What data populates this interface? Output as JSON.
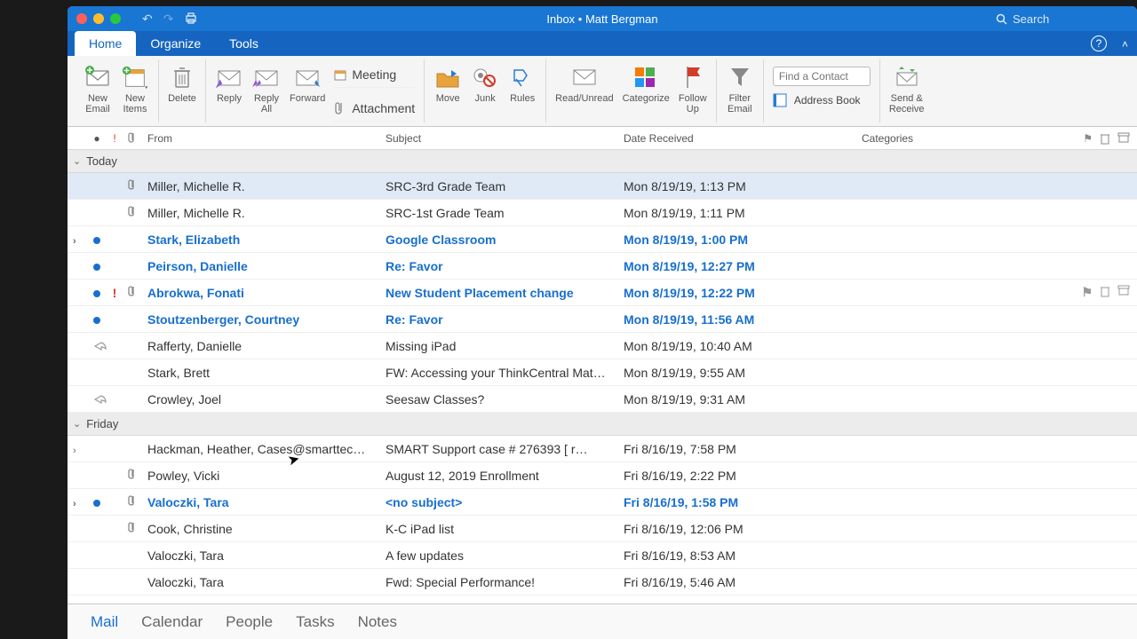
{
  "title": "Inbox • Matt Bergman",
  "search_placeholder": "Search",
  "tabs": {
    "home": "Home",
    "organize": "Organize",
    "tools": "Tools"
  },
  "ribbon": {
    "new_email": "New\nEmail",
    "new_items": "New\nItems",
    "delete": "Delete",
    "reply": "Reply",
    "reply_all": "Reply\nAll",
    "forward": "Forward",
    "meeting": "Meeting",
    "attachment": "Attachment",
    "move": "Move",
    "junk": "Junk",
    "rules": "Rules",
    "read_unread": "Read/Unread",
    "categorize": "Categorize",
    "follow_up": "Follow\nUp",
    "filter_email": "Filter\nEmail",
    "find_contact_placeholder": "Find a Contact",
    "address_book": "Address Book",
    "send_receive": "Send &\nReceive"
  },
  "columns": {
    "from": "From",
    "subject": "Subject",
    "date": "Date Received",
    "categories": "Categories"
  },
  "groups": [
    {
      "label": "Today",
      "rows": [
        {
          "from": "Miller, Michelle R.",
          "subject": "SRC-3rd Grade Team",
          "date": "Mon 8/19/19, 1:13 PM",
          "unread": false,
          "att": true,
          "imp": false,
          "exp": false,
          "reply": false,
          "sel": true
        },
        {
          "from": "Miller, Michelle R.",
          "subject": "SRC-1st Grade Team",
          "date": "Mon 8/19/19, 1:11 PM",
          "unread": false,
          "att": true,
          "imp": false,
          "exp": false,
          "reply": false
        },
        {
          "from": "Stark, Elizabeth",
          "subject": "Google Classroom",
          "date": "Mon 8/19/19, 1:00 PM",
          "unread": true,
          "att": false,
          "imp": false,
          "exp": true,
          "reply": false
        },
        {
          "from": "Peirson, Danielle",
          "subject": "Re: Favor",
          "date": "Mon 8/19/19, 12:27 PM",
          "unread": true,
          "att": false,
          "imp": false,
          "exp": false,
          "reply": false
        },
        {
          "from": "Abrokwa, Fonati",
          "subject": "New Student Placement change",
          "date": "Mon 8/19/19, 12:22 PM",
          "unread": true,
          "att": true,
          "imp": true,
          "exp": false,
          "reply": false,
          "tail": true
        },
        {
          "from": "Stoutzenberger, Courtney",
          "subject": "Re: Favor",
          "date": "Mon 8/19/19, 11:56 AM",
          "unread": true,
          "att": false,
          "imp": false,
          "exp": false,
          "reply": false
        },
        {
          "from": "Rafferty, Danielle",
          "subject": "Missing iPad",
          "date": "Mon 8/19/19, 10:40 AM",
          "unread": false,
          "att": false,
          "imp": false,
          "exp": false,
          "reply": true
        },
        {
          "from": "Stark, Brett",
          "subject": "FW: Accessing your ThinkCentral Mat…",
          "date": "Mon 8/19/19, 9:55 AM",
          "unread": false,
          "att": false,
          "imp": false,
          "exp": false,
          "reply": false
        },
        {
          "from": "Crowley, Joel",
          "subject": "Seesaw Classes?",
          "date": "Mon 8/19/19, 9:31 AM",
          "unread": false,
          "att": false,
          "imp": false,
          "exp": false,
          "reply": true
        }
      ]
    },
    {
      "label": "Friday",
      "rows": [
        {
          "from": "Hackman, Heather, Cases@smarttec…",
          "subject": "SMART Support case # 276393   [ r…",
          "date": "Fri 8/16/19, 7:58 PM",
          "unread": false,
          "att": false,
          "imp": false,
          "exp": true,
          "reply": false
        },
        {
          "from": "Powley, Vicki",
          "subject": "August 12, 2019 Enrollment",
          "date": "Fri 8/16/19, 2:22 PM",
          "unread": false,
          "att": true,
          "imp": false,
          "exp": false,
          "reply": false
        },
        {
          "from": "Valoczki, Tara",
          "subject": "<no subject>",
          "date": "Fri 8/16/19, 1:58 PM",
          "unread": true,
          "att": true,
          "imp": false,
          "exp": true,
          "reply": false
        },
        {
          "from": "Cook, Christine",
          "subject": "K-C iPad list",
          "date": "Fri 8/16/19, 12:06 PM",
          "unread": false,
          "att": true,
          "imp": false,
          "exp": false,
          "reply": false
        },
        {
          "from": "Valoczki, Tara",
          "subject": "A few updates",
          "date": "Fri 8/16/19, 8:53 AM",
          "unread": false,
          "att": false,
          "imp": false,
          "exp": false,
          "reply": false
        },
        {
          "from": "Valoczki, Tara",
          "subject": "Fwd: Special Performance!",
          "date": "Fri 8/16/19, 5:46 AM",
          "unread": false,
          "att": false,
          "imp": false,
          "exp": false,
          "reply": false
        }
      ]
    }
  ],
  "nav": {
    "mail": "Mail",
    "calendar": "Calendar",
    "people": "People",
    "tasks": "Tasks",
    "notes": "Notes"
  }
}
